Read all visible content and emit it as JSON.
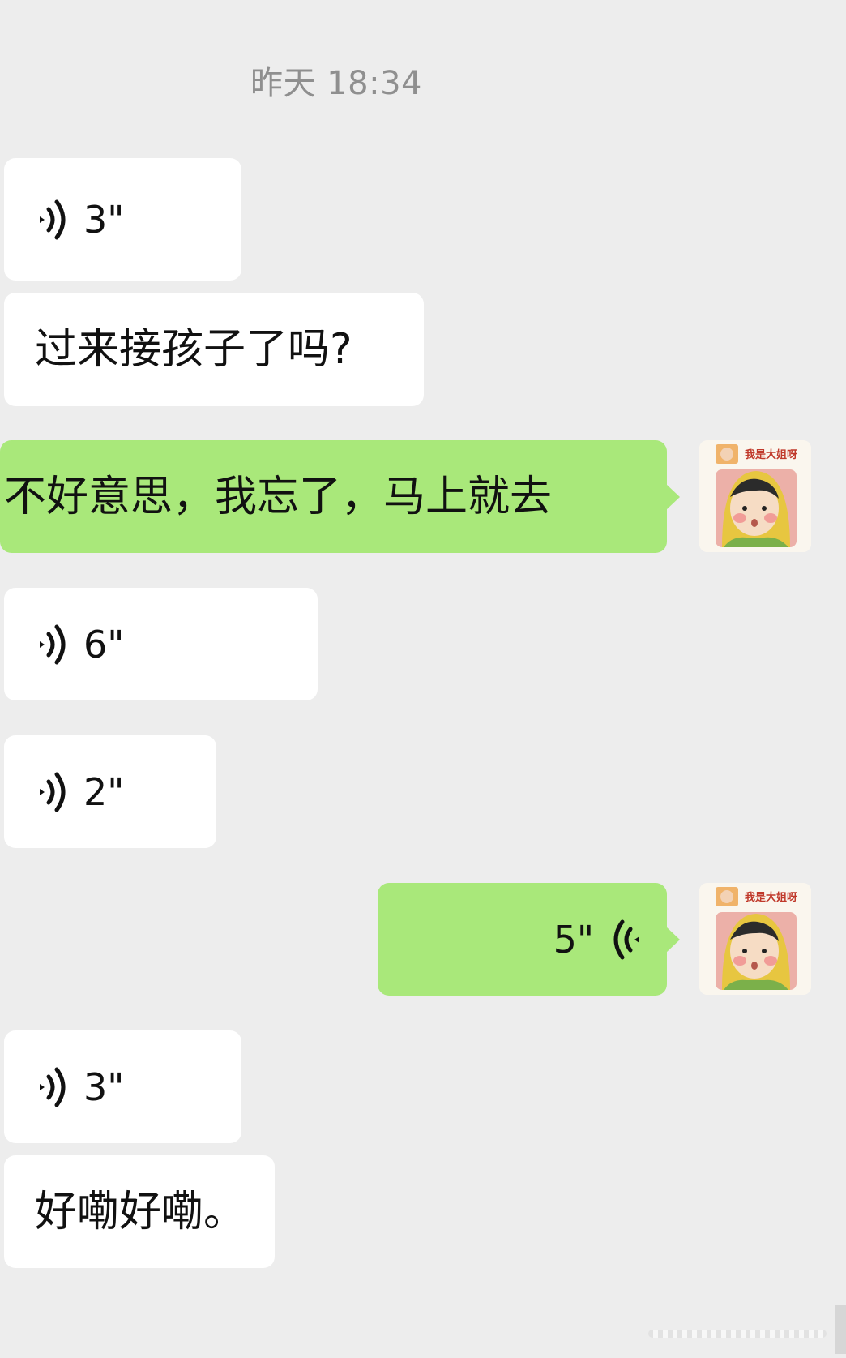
{
  "chat": {
    "timestamp": "昨天 18:34",
    "messages": [
      {
        "direction": "in",
        "kind": "voice",
        "duration": "3\""
      },
      {
        "direction": "in",
        "kind": "text",
        "text": "过来接孩子了吗?"
      },
      {
        "direction": "out",
        "kind": "text",
        "text": "不好意思，我忘了，马上就去"
      },
      {
        "direction": "in",
        "kind": "voice",
        "duration": "6\""
      },
      {
        "direction": "in",
        "kind": "voice",
        "duration": "2\""
      },
      {
        "direction": "out",
        "kind": "voice",
        "duration": "5\""
      },
      {
        "direction": "in",
        "kind": "voice",
        "duration": "3\""
      },
      {
        "direction": "in",
        "kind": "text",
        "text": "好嘞好嘞。"
      }
    ]
  },
  "avatar": {
    "label": "我是大姐呀",
    "icon": "cartoon-girl-avatar"
  },
  "colors": {
    "background": "#ededed",
    "incoming_bubble": "#ffffff",
    "outgoing_bubble": "#a9e87a",
    "timestamp_text": "#8f8f8f"
  }
}
